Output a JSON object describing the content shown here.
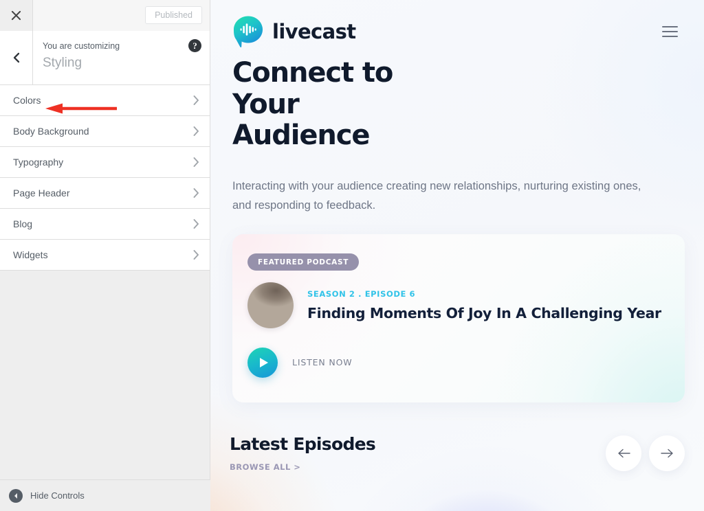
{
  "customizer": {
    "close_icon": "close-icon",
    "published_label": "Published",
    "back_icon": "chevron-left-icon",
    "customizing_label": "You are customizing",
    "panel_title": "Styling",
    "help_icon": "help-icon",
    "help_glyph": "?",
    "items": [
      {
        "label": "Colors",
        "chevron": "chevron-right-icon"
      },
      {
        "label": "Body Background",
        "chevron": "chevron-right-icon"
      },
      {
        "label": "Typography",
        "chevron": "chevron-right-icon"
      },
      {
        "label": "Page Header",
        "chevron": "chevron-right-icon"
      },
      {
        "label": "Blog",
        "chevron": "chevron-right-icon"
      },
      {
        "label": "Widgets",
        "chevron": "chevron-right-icon"
      }
    ],
    "hide_controls_label": "Hide Controls",
    "hide_controls_icon": "collapse-left-icon"
  },
  "annotation": {
    "type": "arrow",
    "color": "#ee3124",
    "points_to": "Colors"
  },
  "preview": {
    "header": {
      "brand_name": "livecast",
      "logo_icon": "speech-bubble-waveform-logo",
      "menu_icon": "hamburger-menu-icon"
    },
    "hero": {
      "heading": "Connect to Your Audience",
      "paragraph": "Interacting with your audience creating new relationships, nurturing existing ones, and responding to feedback."
    },
    "featured": {
      "badge": "FEATURED PODCAST",
      "season": "SEASON 2 . EPISODE 6",
      "title": "Finding Moments Of Joy In A Challenging Year",
      "listen_label": "LISTEN NOW",
      "play_icon": "play-icon",
      "thumbnail_icon": "episode-thumbnail"
    },
    "latest": {
      "heading": "Latest Episodes",
      "browse_all": "BROWSE ALL >",
      "prev_icon": "arrow-left-icon",
      "next_icon": "arrow-right-icon"
    }
  },
  "colors": {
    "accent_cyan": "#31c3e8",
    "accent_teal": "#1fd4b4",
    "heading_dark": "#101a2c",
    "badge_purple": "#9691ab",
    "annotation_red": "#ee3124",
    "wp_text": "#555d66"
  }
}
